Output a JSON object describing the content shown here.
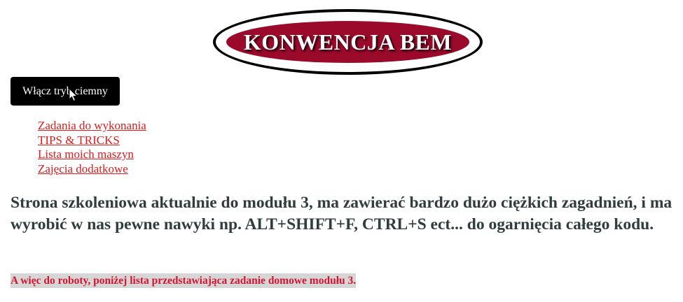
{
  "logo": {
    "text": "KONWENCJA BEM"
  },
  "theme_button": {
    "label": "Włącz tryb ciemny"
  },
  "nav": {
    "items": [
      {
        "label": "Zadania do wykonania"
      },
      {
        "label": "TIPS & TRICKS"
      },
      {
        "label": "Lista moich maszyn"
      },
      {
        "label": "Zajęcia dodatkowe"
      }
    ]
  },
  "main": {
    "heading": "Strona szkoleniowa aktualnie do modułu 3, ma zawierać bardzo dużo ciężkich zagadnień, i ma wyrobić w nas pewne nawyki np. ALT+SHIFT+F, CTRL+S ect... do ogarnięcia całego kodu.",
    "subline": "A więc do roboty, poniżej lista przedstawiająca zadanie domowe modułu 3."
  },
  "colors": {
    "logo_background": "#9b0a2a",
    "link": "#e01b1b",
    "heading": "#2f3d3f",
    "subline_text": "#d4142e",
    "subline_background": "#d6d6d6"
  }
}
